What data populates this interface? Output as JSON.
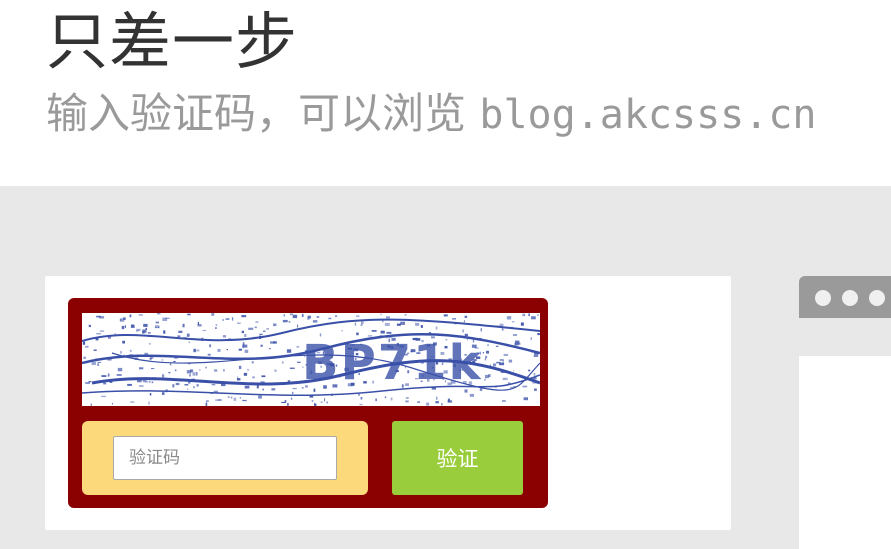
{
  "header": {
    "title": "只差一步",
    "subtitle_text": "输入验证码，可以浏览 ",
    "subtitle_url": "blog.akcsss.cn"
  },
  "captcha": {
    "image_text": "BP71k",
    "input_placeholder": "验证码",
    "input_value": "",
    "submit_label": "验证"
  },
  "colors": {
    "panel": "#8b0000",
    "input_area": "#fcd97a",
    "button": "#9acd3c",
    "captcha_ink": "#3a50a8"
  },
  "icons": [
    "browser-dot-icon",
    "browser-dot-icon",
    "browser-dot-icon"
  ]
}
